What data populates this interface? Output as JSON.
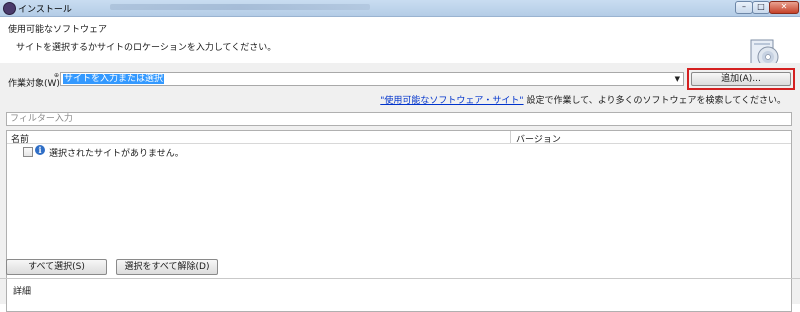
{
  "window": {
    "title": "インストール"
  },
  "header": {
    "title": "使用可能なソフトウェア",
    "description": "サイトを選択するかサイトのロケーションを入力してください。",
    "icon": "install-cd-icon"
  },
  "work_with": {
    "label": "作業対象(W):",
    "marker": "⊕",
    "value": "サイトを入力または選択",
    "add_button": "追加(A)..."
  },
  "hint": {
    "link": "\"使用可能なソフトウェア・サイト\"",
    "text": "設定で作業して、より多くのソフトウェアを検索してください。"
  },
  "filter": {
    "placeholder": "フィルター入力"
  },
  "table": {
    "columns": [
      "名前",
      "バージョン"
    ],
    "rows": [
      {
        "name": "選択されたサイトがありません。",
        "version": "",
        "checked": false
      }
    ]
  },
  "buttons": {
    "select_all": "すべて選択(S)",
    "deselect_all": "選択をすべて解除(D)"
  },
  "details": {
    "label": "詳細"
  },
  "colors": {
    "selection": "#3399ff",
    "highlight_border": "#d42020",
    "link": "#0033cc"
  }
}
